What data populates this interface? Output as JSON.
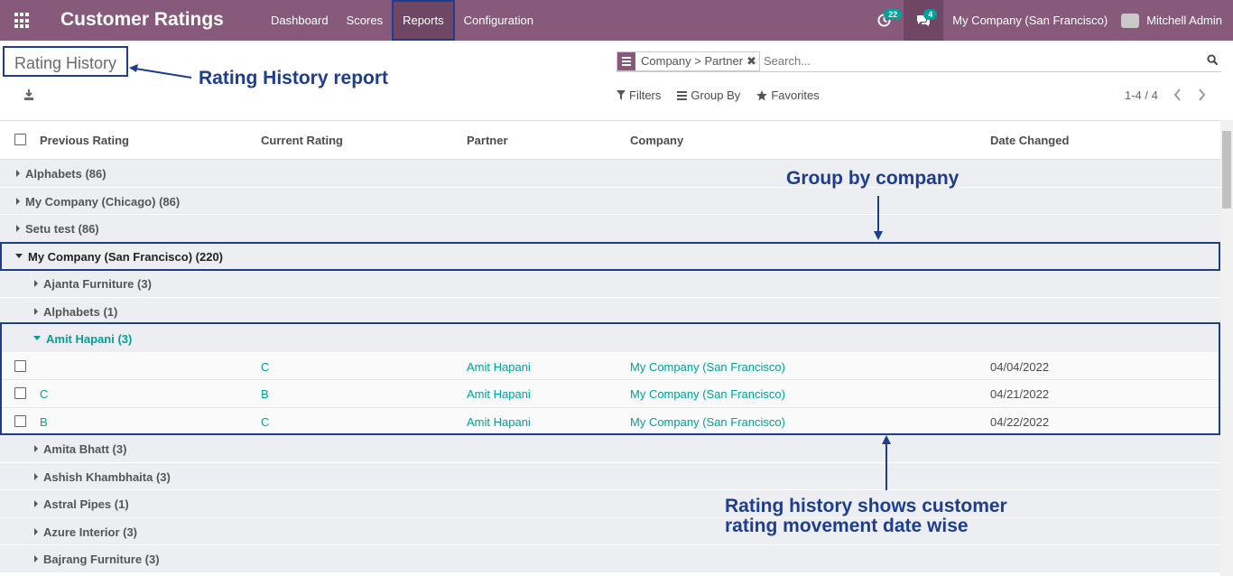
{
  "navbar": {
    "app_title": "Customer Ratings",
    "menu": [
      "Dashboard",
      "Scores",
      "Reports",
      "Configuration"
    ],
    "active_menu": "Reports",
    "activity_count": "22",
    "message_count": "4",
    "company": "My Company (San Francisco)",
    "user": "Mitchell Admin"
  },
  "control_panel": {
    "breadcrumb": "Rating History",
    "facet_label": "Company > Partner",
    "search_placeholder": "Search...",
    "filters_label": "Filters",
    "groupby_label": "Group By",
    "favorites_label": "Favorites",
    "pager": "1-4 / 4"
  },
  "list": {
    "headers": [
      "Previous Rating",
      "Current Rating",
      "Partner",
      "Company",
      "Date Changed"
    ],
    "top_groups": [
      {
        "label": "Alphabets (86)"
      },
      {
        "label": "My Company (Chicago) (86)"
      },
      {
        "label": "Setu test (86)"
      }
    ],
    "open_group": {
      "label": "My Company (San Francisco) (220)"
    },
    "sub_groups_before": [
      {
        "label": "Ajanta Furniture (3)"
      },
      {
        "label": "Alphabets (1)"
      }
    ],
    "open_sub_group": {
      "label": "Amit Hapani (3)"
    },
    "records": [
      {
        "previous": "",
        "current": "C",
        "partner": "Amit Hapani",
        "company": "My Company (San Francisco)",
        "date": "04/04/2022"
      },
      {
        "previous": "C",
        "current": "B",
        "partner": "Amit Hapani",
        "company": "My Company (San Francisco)",
        "date": "04/21/2022"
      },
      {
        "previous": "B",
        "current": "C",
        "partner": "Amit Hapani",
        "company": "My Company (San Francisco)",
        "date": "04/22/2022"
      }
    ],
    "sub_groups_after": [
      {
        "label": "Amita Bhatt (3)"
      },
      {
        "label": "Ashish Khambhaita (3)"
      },
      {
        "label": "Astral Pipes (1)"
      },
      {
        "label": "Azure Interior (3)"
      },
      {
        "label": "Bajrang Furniture (3)"
      }
    ]
  },
  "annotations": {
    "report": "Rating History report",
    "groupby": "Group by company",
    "history_line1": "Rating history shows customer",
    "history_line2": "rating movement date wise"
  },
  "colors": {
    "navbar": "#875a7b",
    "accent": "#00a09d",
    "annotation": "#1d3d8f"
  }
}
